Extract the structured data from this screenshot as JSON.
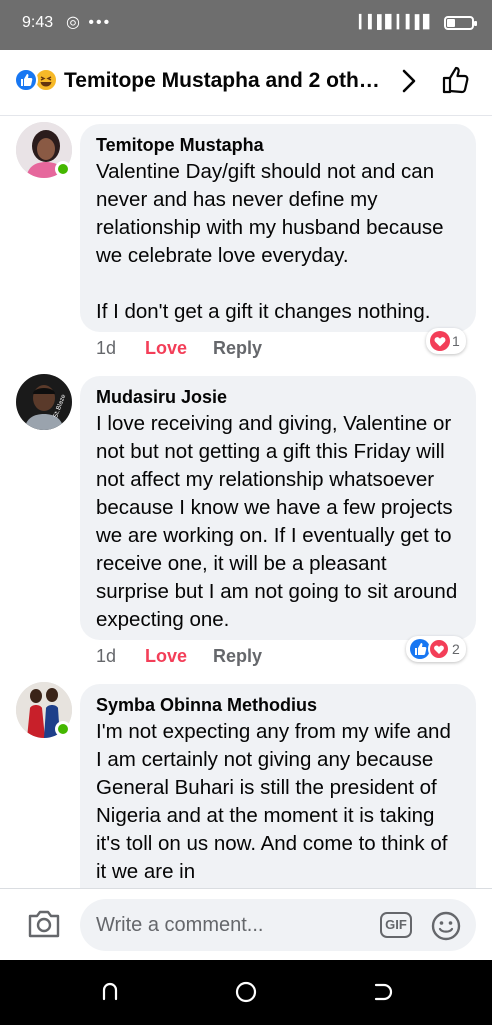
{
  "status_bar": {
    "time": "9:43",
    "extra_icons": "◎ •••",
    "signal": "▎▍▌▋ ▎▍▌▋"
  },
  "header": {
    "title": "Temitope Mustapha and 2 othe...",
    "reactions": [
      "like-icon",
      "haha-icon"
    ]
  },
  "comments": [
    {
      "name": "Temitope Mustapha",
      "text": "Valentine Day/gift should not and can never and has never define my relationship with my husband because we celebrate love everyday.\n\nIf I don't get a gift it changes nothing.",
      "time": "1d",
      "love_label": "Love",
      "reply_label": "Reply",
      "reaction_count": "1",
      "online": true
    },
    {
      "name": "Mudasiru Josie",
      "text": "I love receiving and giving,  Valentine or not but not getting a gift this Friday will not affect my relationship whatsoever because I know we have a few projects we are working on. If I eventually get to receive one, it will be a pleasant surprise but I am not going to sit around expecting one.",
      "time": "1d",
      "love_label": "Love",
      "reply_label": "Reply",
      "reaction_count": "2",
      "online": false
    },
    {
      "name": "Symba Obinna Methodius",
      "text": "I'm not expecting any from my wife and I am certainly not giving any because General Buhari is still the president of Nigeria and at the moment it is taking it's toll on us now. And come to think of it we are in",
      "online": true
    }
  ],
  "composer": {
    "placeholder": "Write a comment...",
    "gif_label": "GIF"
  },
  "colors": {
    "love": "#f33e58",
    "like": "#1877f2",
    "bubble": "#f0f2f5",
    "online": "#44b700"
  }
}
